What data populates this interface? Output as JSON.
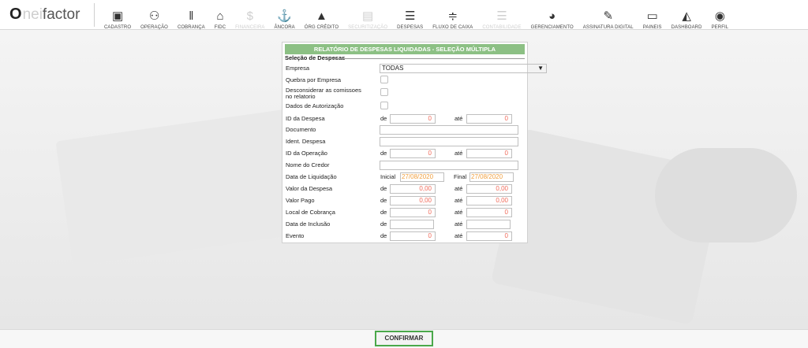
{
  "brand": {
    "o": "O",
    "nei": "nei",
    "factor": "factor"
  },
  "nav": [
    {
      "label": "CADASTRO",
      "icon": "id-card-icon",
      "glyph": "▣",
      "dim": false
    },
    {
      "label": "OPERAÇÃO",
      "icon": "handshake-icon",
      "glyph": "⚇",
      "dim": false
    },
    {
      "label": "COBRANÇA",
      "icon": "barcode-icon",
      "glyph": "‖",
      "dim": false
    },
    {
      "label": "FIDC",
      "icon": "bank-icon",
      "glyph": "⌂",
      "dim": false
    },
    {
      "label": "FINANCEIRA",
      "icon": "money-icon",
      "glyph": "$",
      "dim": true
    },
    {
      "label": "ÂNCORA",
      "icon": "anchor-icon",
      "glyph": "⚓",
      "dim": false
    },
    {
      "label": "ÓRG CRÉDITO",
      "icon": "warning-icon",
      "glyph": "▲",
      "dim": false
    },
    {
      "label": "SECURITIZAÇÃO",
      "icon": "document-icon",
      "glyph": "▤",
      "dim": true
    },
    {
      "label": "DESPESAS",
      "icon": "list-icon",
      "glyph": "☰",
      "dim": false
    },
    {
      "label": "FLUXO DE CAIXA",
      "icon": "sliders-icon",
      "glyph": "≑",
      "dim": false
    },
    {
      "label": "CONTABILIDADE",
      "icon": "ledger-icon",
      "glyph": "☰",
      "dim": true
    },
    {
      "label": "GERENCIAMENTO",
      "icon": "pie-chart-icon",
      "glyph": "◕",
      "dim": false
    },
    {
      "label": "ASSINATURA DIGITAL",
      "icon": "pen-icon",
      "glyph": "✎",
      "dim": false
    },
    {
      "label": "PAINEIS",
      "icon": "monitor-icon",
      "glyph": "▭",
      "dim": false
    },
    {
      "label": "DASHBOARD",
      "icon": "area-chart-icon",
      "glyph": "◭",
      "dim": false
    },
    {
      "label": "PERFIL",
      "icon": "user-icon",
      "glyph": "◉",
      "dim": false
    }
  ],
  "form": {
    "title": "RELATÓRIO DE DESPESAS LIQUIDADAS - SELEÇÃO MÚLTIPLA",
    "fieldset": "Seleção de Despesas",
    "empresa_label": "Empresa",
    "empresa_value": "TODAS",
    "quebra_label": "Quebra por Empresa",
    "desconsiderar_label_1": "Desconsiderar as comissoes",
    "desconsiderar_label_2": "no relatorio",
    "dados_autorizacao_label": "Dados de Autorização",
    "id_despesa_label": "ID da Despesa",
    "documento_label": "Documento",
    "ident_despesa_label": "Ident. Despesa",
    "id_operacao_label": "ID da Operação",
    "nome_credor_label": "Nome do Credor",
    "data_liquidacao_label": "Data de Liquidação",
    "valor_despesa_label": "Valor da Despesa",
    "valor_pago_label": "Valor Pago",
    "local_cobranca_label": "Local de Cobrança",
    "data_inclusao_label": "Data de Inclusão",
    "evento_label": "Evento",
    "de": "de",
    "ate": "até",
    "inicial": "Inicial",
    "final": "Final",
    "zero": "0",
    "zero_money": "0,00",
    "date_start": "27/08/2020",
    "date_end": "27/08/2020"
  },
  "footer": {
    "confirm": "CONFIRMAR"
  }
}
